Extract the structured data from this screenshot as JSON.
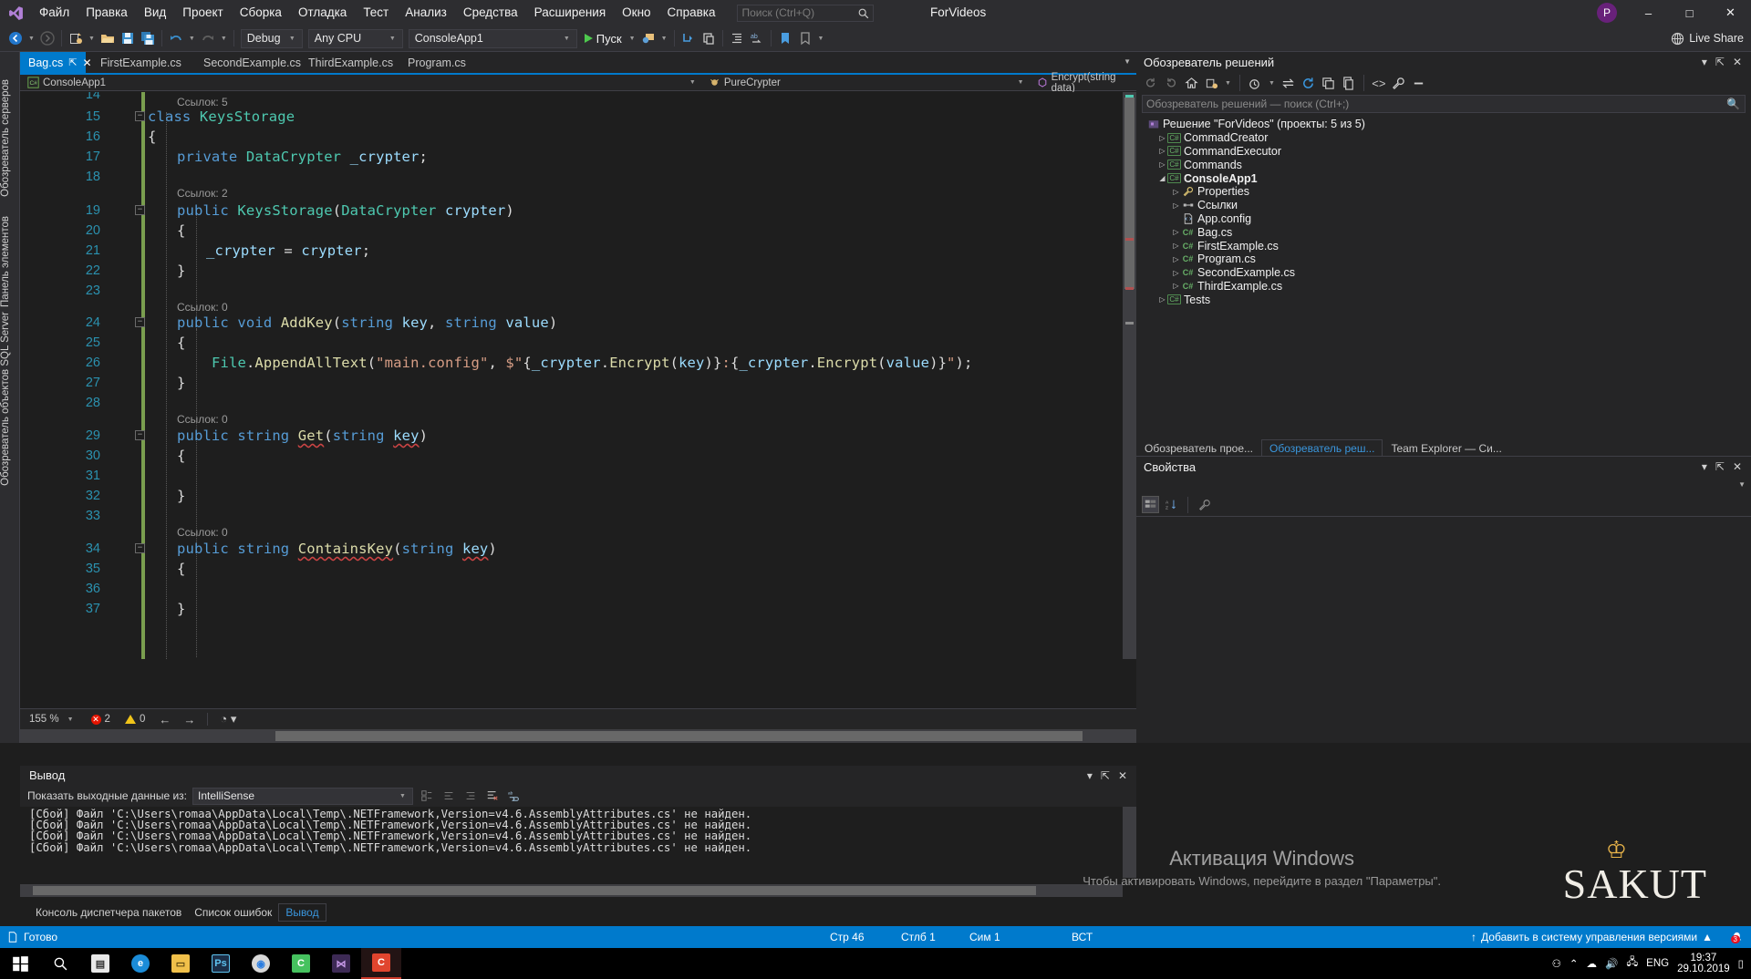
{
  "titlebar": {
    "logo": "visual-studio-logo",
    "menu": [
      "Файл",
      "Правка",
      "Вид",
      "Проект",
      "Сборка",
      "Отладка",
      "Тест",
      "Анализ",
      "Средства",
      "Расширения",
      "Окно",
      "Справка"
    ],
    "search_placeholder": "Поиск (Ctrl+Q)",
    "app_title": "ForVideos",
    "account_initial": "P",
    "minimize": "–",
    "maximize": "□",
    "close": "✕"
  },
  "toolbar": {
    "back": "◀",
    "forward": "▶",
    "new_project": "new-project-icon",
    "open": "open-folder-icon",
    "save": "save-icon",
    "save_all": "save-all-icon",
    "undo": "undo-icon",
    "redo": "redo-icon",
    "config": "Debug",
    "platform": "Any CPU",
    "startup_project": "ConsoleApp1",
    "run_label": "Пуск",
    "live_share": "Live Share"
  },
  "left_rail": {
    "items": [
      "Обозреватель серверов",
      "Панель элементов",
      "Обозреватель объектов SQL Server"
    ]
  },
  "editor": {
    "tabs": [
      {
        "label": "Bag.cs",
        "active": true,
        "pinned": true,
        "closable": true
      },
      {
        "label": "FirstExample.cs",
        "active": false
      },
      {
        "label": "SecondExample.cs",
        "active": false
      },
      {
        "label": "ThirdExample.cs",
        "active": false
      },
      {
        "label": "Program.cs",
        "active": false
      }
    ],
    "breadcrumb": {
      "project": "ConsoleApp1",
      "type": "PureCrypter",
      "member": "Encrypt(string data)"
    },
    "codelens": {
      "refs_5": "Ссылок: 5",
      "refs_2": "Ссылок: 2",
      "refs_0": "Ссылок: 0"
    },
    "lines": [
      {
        "n": "14",
        "code": ""
      },
      {
        "n": "15",
        "code": "class KeysStorage"
      },
      {
        "n": "16",
        "code": "{"
      },
      {
        "n": "17",
        "code": "private DataCrypter _crypter;"
      },
      {
        "n": "18",
        "code": ""
      },
      {
        "n": "19",
        "code": "public KeysStorage(DataCrypter crypter)"
      },
      {
        "n": "20",
        "code": "{"
      },
      {
        "n": "21",
        "code": "_crypter = crypter;"
      },
      {
        "n": "22",
        "code": "}"
      },
      {
        "n": "23",
        "code": ""
      },
      {
        "n": "24",
        "code": "public void AddKey(string key, string value)"
      },
      {
        "n": "25",
        "code": "{"
      },
      {
        "n": "26",
        "code": "File.AppendAllText(\"main.config\", $\"{_crypter.Encrypt(key)}:{_crypter.Encrypt(value)}\");"
      },
      {
        "n": "27",
        "code": "}"
      },
      {
        "n": "28",
        "code": ""
      },
      {
        "n": "29",
        "code": "public string Get(string key)"
      },
      {
        "n": "30",
        "code": "{"
      },
      {
        "n": "31",
        "code": ""
      },
      {
        "n": "32",
        "code": "}"
      },
      {
        "n": "33",
        "code": ""
      },
      {
        "n": "34",
        "code": "public string ContainsKey(string key)"
      },
      {
        "n": "35",
        "code": "{"
      },
      {
        "n": "36",
        "code": ""
      },
      {
        "n": "37",
        "code": "}"
      }
    ],
    "status": {
      "zoom": "155 %",
      "errors": "2",
      "warnings": "0",
      "prev": "←",
      "next": "→"
    }
  },
  "solution_explorer": {
    "title": "Обозреватель решений",
    "search_placeholder": "Обозреватель решений — поиск (Ctrl+;)",
    "root": "Решение \"ForVideos\" (проекты: 5 из 5)",
    "tree": [
      {
        "label": "CommadCreator",
        "indent": 1,
        "icon": "csharp-project-icon",
        "arrow": "▷"
      },
      {
        "label": "CommandExecutor",
        "indent": 1,
        "icon": "csharp-project-icon",
        "arrow": "▷"
      },
      {
        "label": "Commands",
        "indent": 1,
        "icon": "csharp-project-icon",
        "arrow": "▷"
      },
      {
        "label": "ConsoleApp1",
        "indent": 1,
        "icon": "csharp-project-icon",
        "arrow": "◢",
        "bold": true
      },
      {
        "label": "Properties",
        "indent": 2,
        "icon": "wrench-icon",
        "arrow": "▷"
      },
      {
        "label": "Ссылки",
        "indent": 2,
        "icon": "references-icon",
        "arrow": "▷"
      },
      {
        "label": "App.config",
        "indent": 2,
        "icon": "config-file-icon",
        "arrow": ""
      },
      {
        "label": "Bag.cs",
        "indent": 2,
        "icon": "csharp-file-icon",
        "arrow": "▷"
      },
      {
        "label": "FirstExample.cs",
        "indent": 2,
        "icon": "csharp-file-icon",
        "arrow": "▷"
      },
      {
        "label": "Program.cs",
        "indent": 2,
        "icon": "csharp-file-icon",
        "arrow": "▷"
      },
      {
        "label": "SecondExample.cs",
        "indent": 2,
        "icon": "csharp-file-icon",
        "arrow": "▷"
      },
      {
        "label": "ThirdExample.cs",
        "indent": 2,
        "icon": "csharp-file-icon",
        "arrow": "▷"
      },
      {
        "label": "Tests",
        "indent": 1,
        "icon": "csharp-project-icon",
        "arrow": "▷"
      }
    ]
  },
  "dock_tabs": [
    {
      "label": "Обозреватель прое...",
      "active": false
    },
    {
      "label": "Обозреватель реш...",
      "active": true
    },
    {
      "label": "Team Explorer — Си...",
      "active": false
    }
  ],
  "properties": {
    "title": "Свойства",
    "categorized": "categorized-icon",
    "alphabetical": "alphabetical-sort-icon",
    "property_pages": "property-pages-icon"
  },
  "output": {
    "title": "Вывод",
    "source_label": "Показать выходные данные из:",
    "source_value": "IntelliSense",
    "lines": [
      "[Сбой] Файл 'C:\\Users\\romaa\\AppData\\Local\\Temp\\.NETFramework,Version=v4.6.AssemblyAttributes.cs' не найден.",
      "[Сбой] Файл 'C:\\Users\\romaa\\AppData\\Local\\Temp\\.NETFramework,Version=v4.6.AssemblyAttributes.cs' не найден.",
      "[Сбой] Файл 'C:\\Users\\romaa\\AppData\\Local\\Temp\\.NETFramework,Version=v4.6.AssemblyAttributes.cs' не найден.",
      "[Сбой] Файл 'C:\\Users\\romaa\\AppData\\Local\\Temp\\.NETFramework,Version=v4.6.AssemblyAttributes.cs' не найден."
    ]
  },
  "bottom_tabs": [
    {
      "label": "Консоль диспетчера пакетов",
      "active": false
    },
    {
      "label": "Список ошибок",
      "active": false
    },
    {
      "label": "Вывод",
      "active": true
    }
  ],
  "statusbar": {
    "state": "Готово",
    "line": "Стр 46",
    "column": "Стлб 1",
    "char": "Сим 1",
    "insert_mode": "ВСТ",
    "vcs": "Добавить в систему управления версиями",
    "notifications": "3"
  },
  "watermark": {
    "line1": "Активация Windows",
    "line2": "Чтобы активировать Windows, перейдите в раздел \"Параметры\".",
    "brand": "SAKUT"
  },
  "taskbar": {
    "start": "start-icon",
    "search": "search-icon",
    "items": [
      "store-icon",
      "edge-icon",
      "explorer-icon",
      "photoshop-icon",
      "chrome-icon",
      "telegram-icon",
      "visual-studio-icon",
      "vs-active-icon"
    ],
    "tray": [
      "people-icon",
      "chevron-up-icon",
      "onedrive-icon",
      "volume-icon",
      "network-icon"
    ],
    "language": "ENG",
    "time": "19:37",
    "date": "29.10.2019"
  },
  "colors": {
    "accent": "#007acc",
    "chrome": "#2d2d30",
    "editor_bg": "#1e1e1e",
    "panel_bg": "#252526",
    "keyword": "#569cd6",
    "type": "#4ec9b0",
    "string": "#d69d85",
    "method": "#dcdcaa",
    "linenum": "#2b91af",
    "error": "#e51400"
  }
}
